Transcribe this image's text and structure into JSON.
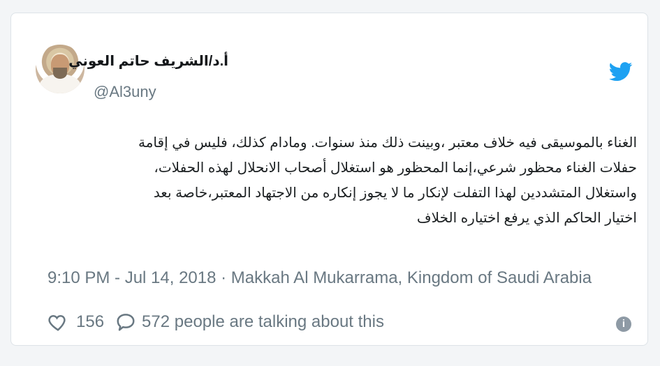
{
  "tweet": {
    "author_name": "أ.د/الشريف حاتم العوني",
    "handle": "@Al3uny",
    "text_lines": [
      "الغناء بالموسيقى فيه خلاف معتبر ،وبينت ذلك منذ سنوات. ومادام كذلك، فليس في إقامة",
      "حفلات الغناء محظور شرعي،إنما المحظور هو استغلال أصحاب الانحلال لهذه الحفلات،",
      "واستغلال المتشددين لهذا التفلت لإنكار ما لا يجوز إنكاره من الاجتهاد المعتبر،خاصة بعد",
      "اختيار الحاكم الذي يرفع اختياره الخلاف"
    ],
    "meta": "9:10 PM - Jul 14, 2018 · Makkah Al Mukarrama, Kingdom of Saudi Arabia",
    "like_count": "156",
    "talking_text": "572 people are talking about this"
  },
  "icons": {
    "logo": "twitter-logo",
    "like": "heart-icon",
    "reply": "speech-bubble-icon",
    "info": "info-icon"
  },
  "colors": {
    "twitter_blue": "#1da1f2",
    "muted_gray": "#697882",
    "text": "#1c2022"
  }
}
